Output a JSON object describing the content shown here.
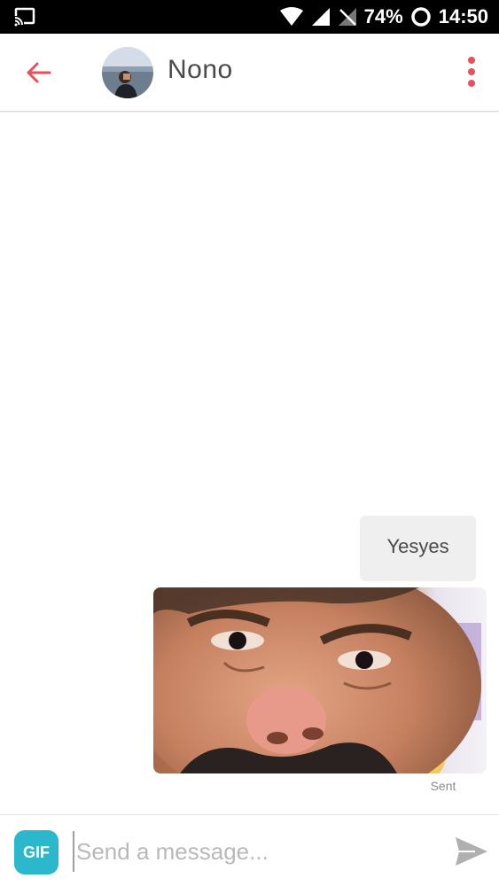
{
  "status_bar": {
    "battery": "74%",
    "time": "14:50"
  },
  "header": {
    "title": "Nono"
  },
  "messages": [
    {
      "text": "Yesyes"
    }
  ],
  "gif_status": "Sent",
  "composer": {
    "gif_label": "GIF",
    "placeholder": "Send a message..."
  },
  "colors": {
    "accent": "#e9505a",
    "gif_button": "#2bb7cc",
    "bubble": "#efefef"
  },
  "icons": [
    "cast-icon",
    "wifi-icon",
    "signal-icon",
    "no-sim-icon",
    "battery-icon",
    "back-arrow-icon",
    "overflow-menu-icon",
    "send-icon"
  ]
}
